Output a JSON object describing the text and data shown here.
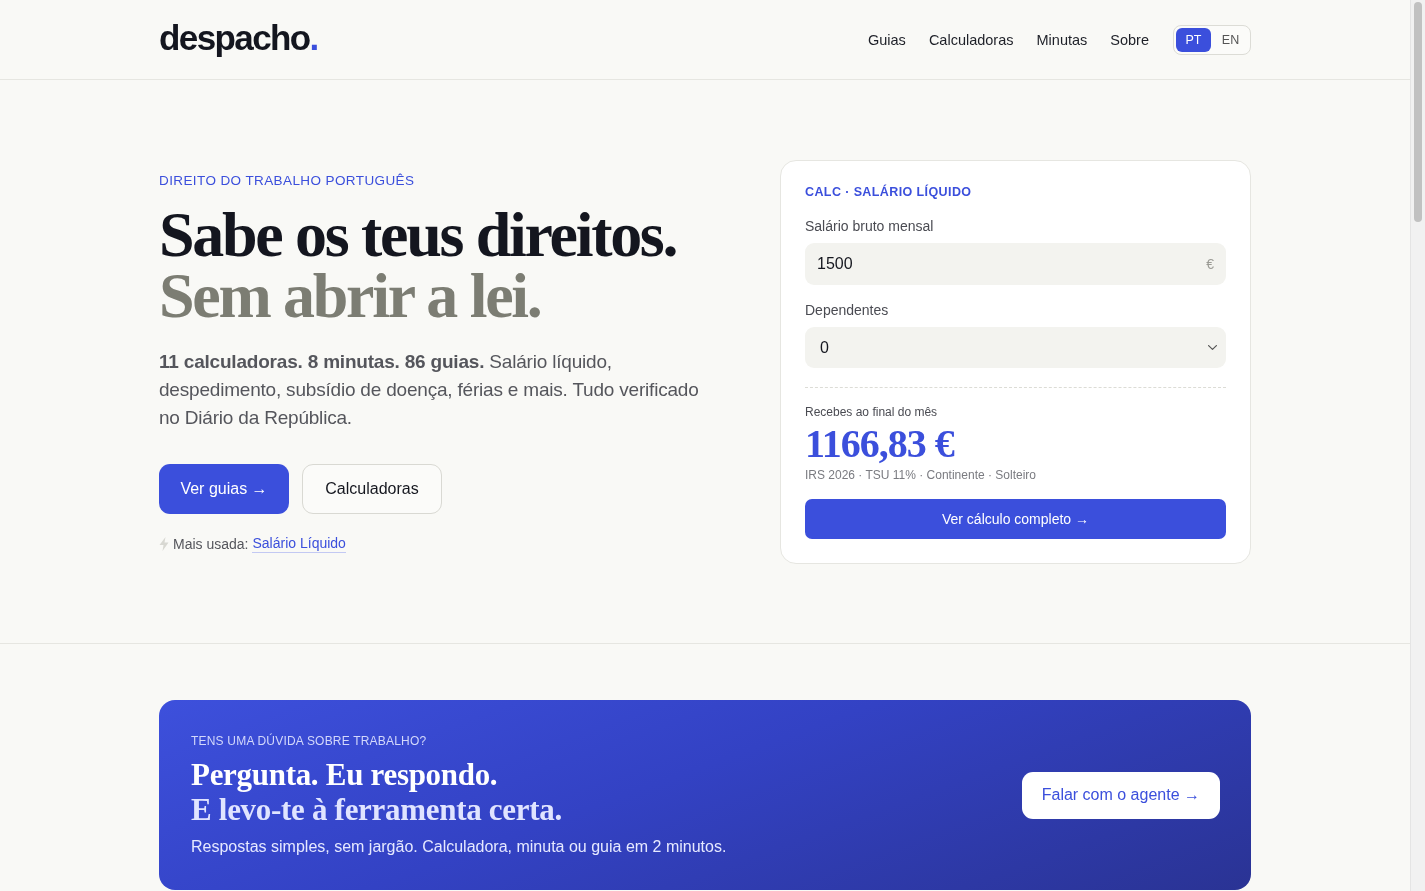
{
  "header": {
    "logo": {
      "text": "despacho",
      "mark": "."
    },
    "nav": [
      {
        "label": "Guias"
      },
      {
        "label": "Calculadoras"
      },
      {
        "label": "Minutas"
      },
      {
        "label": "Sobre"
      }
    ],
    "languages": [
      {
        "label": "PT",
        "selected": true
      },
      {
        "label": "EN",
        "selected": false
      }
    ]
  },
  "hero": {
    "eyebrow": "DIREITO DO TRABALHO PORTUGUÊS",
    "title_lines": [
      {
        "text": "Sabe os teus direitos.",
        "kind": "strong"
      },
      {
        "text": "Sem abrir a lei.",
        "kind": "soft"
      }
    ],
    "description": "**11 calculadoras. 8 minutas. 86 guias.** Salário líquido, despedimento, subsídio de doença, férias e mais. Tudo verificado no Diário da República.",
    "buttons": [
      {
        "label": "Ver guias →",
        "kind": "primary"
      },
      {
        "label": "Calculadoras",
        "kind": "secondary"
      }
    ],
    "most_used": {
      "label": "Mais usada:",
      "link": "Salário Líquido"
    }
  },
  "calculator": {
    "eyebrow": "CALC · SALÁRIO LÍQUIDO",
    "fields": [
      {
        "kind": "input",
        "label": "Salário bruto mensal",
        "value": "1500",
        "suffix": "€"
      },
      {
        "kind": "select",
        "label": "Dependentes",
        "value": "0"
      }
    ],
    "result_label": "Recebes ao final do mês",
    "result_value": "1166,83 €",
    "result_note": "IRS 2026 · TSU 11% · Continente · Solteiro",
    "button": "Ver cálculo completo →"
  },
  "banner": {
    "eyebrow": "TENS UMA DÚVIDA SOBRE TRABALHO?",
    "title_lines": [
      {
        "text": "Pergunta. Eu respondo.",
        "kind": "strong"
      },
      {
        "text": "E levo-te à ferramenta certa.",
        "kind": "soft"
      }
    ],
    "description": "Respostas simples, sem jargão. Calculadora, minuta ou guia em 2 minutos.",
    "button": "Falar com o agente →"
  }
}
